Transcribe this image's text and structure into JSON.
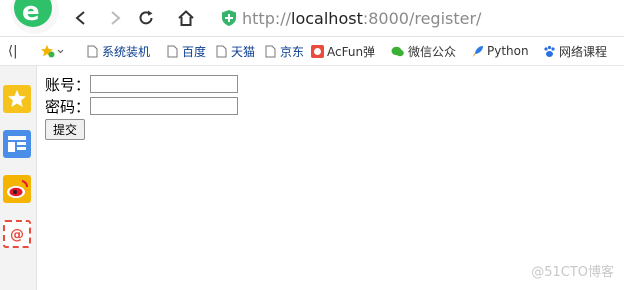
{
  "browser": {
    "url_scheme": "http://",
    "url_host": "localhost",
    "url_rest": ":8000/register/"
  },
  "bookmarks": {
    "collapse_glyph": "⟨|",
    "items": [
      {
        "label": "系统装机",
        "icon": "page-icon"
      },
      {
        "label": "百度",
        "icon": "page-icon"
      },
      {
        "label": "天猫",
        "icon": "page-icon"
      },
      {
        "label": "京东",
        "icon": "page-icon"
      },
      {
        "label": "AcFun弹",
        "icon": "acfun-icon"
      },
      {
        "label": "微信公众",
        "icon": "wechat-icon"
      },
      {
        "label": "Python",
        "icon": "rocket-icon"
      },
      {
        "label": "网络课程",
        "icon": "paw-icon"
      }
    ]
  },
  "form": {
    "account_label": "账号：",
    "password_label": "密码：",
    "account_value": "",
    "password_value": "",
    "submit_label": "提交"
  },
  "watermark": "@51CTO博客"
}
